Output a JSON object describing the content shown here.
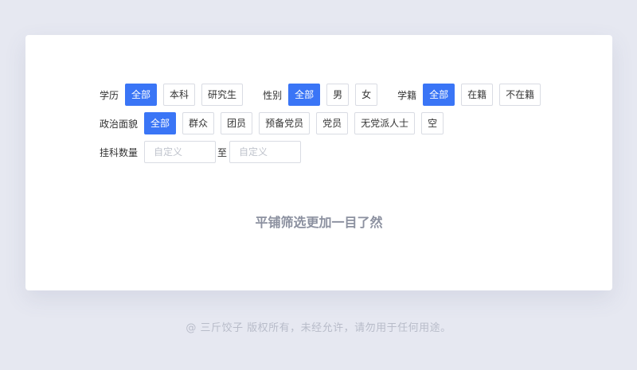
{
  "filters": {
    "education": {
      "label": "学历",
      "options": [
        "全部",
        "本科",
        "研究生"
      ],
      "selected": 0
    },
    "gender": {
      "label": "性别",
      "options": [
        "全部",
        "男",
        "女"
      ],
      "selected": 0
    },
    "enrollment": {
      "label": "学籍",
      "options": [
        "全部",
        "在籍",
        "不在籍"
      ],
      "selected": 0
    },
    "political": {
      "label": "政治面貌",
      "options": [
        "全部",
        "群众",
        "团员",
        "预备党员",
        "党员",
        "无党派人士",
        "空"
      ],
      "selected": 0
    },
    "failed_courses": {
      "label": "挂科数量",
      "min_placeholder": "自定义",
      "to_label": "至",
      "max_placeholder": "自定义"
    }
  },
  "tagline": "平铺筛选更加一目了然",
  "footer": "@ 三斤饺子  版权所有，未经允许，请勿用于任何用途。",
  "colors": {
    "accent": "#3a75f6",
    "background": "#e6e8f1"
  }
}
